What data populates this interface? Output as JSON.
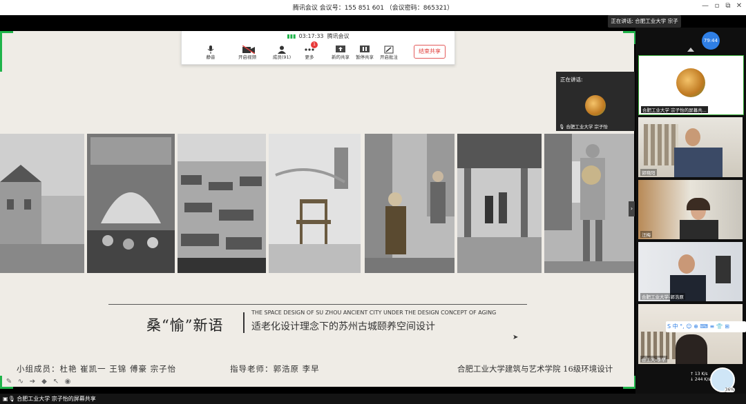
{
  "window": {
    "title": "腾讯会议 会议号：155 851 601 （会议密码：865321）",
    "controls": [
      "—",
      "▫",
      "⧉",
      "✕"
    ]
  },
  "speaking_top": "正在讲话: 合肥工业大学 宗子怡;",
  "toolbar": {
    "timer": "03:17:33",
    "app_name": "腾讯会议",
    "buttons": [
      {
        "label": "静音",
        "icon": "microphone-icon"
      },
      {
        "label": "开启视频",
        "icon": "video-off-icon"
      },
      {
        "label": "成员(91)",
        "icon": "members-icon"
      },
      {
        "label": "更多",
        "icon": "more-icon"
      },
      {
        "label": "新的共享",
        "icon": "share-icon"
      },
      {
        "label": "暂停共享",
        "icon": "pause-icon"
      },
      {
        "label": "开启批注",
        "icon": "annotate-icon"
      }
    ],
    "more_badge": "1",
    "end_share": "结束共享"
  },
  "slide": {
    "title_cn": "桑“愉”新语",
    "title_en": "THE SPACE DESIGN OF SU ZHOU ANCIENT CITY UNDER THE DESIGN CONCEPT OF AGING",
    "subtitle_cn": "适老化设计理念下的苏州古城颐养空间设计",
    "members": "小组成员：杜艳  崔凯一  王锦  傅豪  宗子怡",
    "advisors": "指导老师：郭浩原  李早",
    "school": "合肥工业大学建筑与艺术学院   16级环境设计"
  },
  "speaker_card": {
    "header": "正在讲话:",
    "name": "合肥工业大学 宗子怡"
  },
  "participants_panel": {
    "timer": "79:44",
    "tiles": [
      {
        "name": "合肥工业大学 宗子怡的屏幕共..."
      },
      {
        "name": "郭晓阳"
      },
      {
        "name": "汪梅"
      },
      {
        "name": "合肥工业大学-郭浩原"
      },
      {
        "name": "合工大-李早"
      }
    ]
  },
  "ime": "S 中 °, ☺ ⊕ ⌨ ≡ 👕 ⊞",
  "network": {
    "up": "↑ 13 K/s",
    "down": "↓ 244 K/s"
  },
  "assistant_pct": "36%",
  "bottom_status": "合肥工业大学 宗子怡的屏幕共享",
  "colors": {
    "accent_green": "#1fb44a",
    "end_red": "#e0403c",
    "timer_blue": "#2f7fe5"
  }
}
